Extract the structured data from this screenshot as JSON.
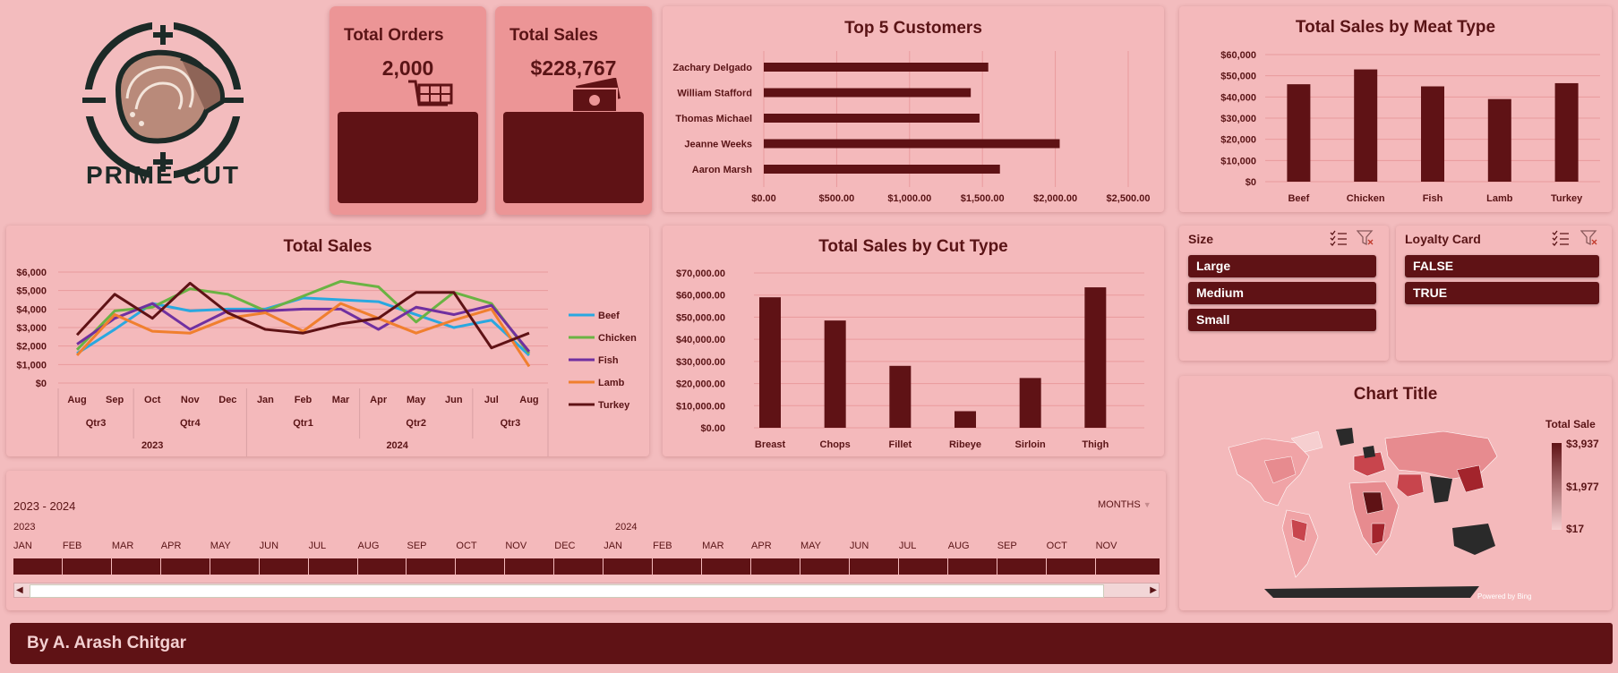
{
  "logo": {
    "text": "PRIME CUT",
    "icon": "steak-crosshair-logo"
  },
  "kpis": {
    "orders": {
      "label": "Total Orders",
      "value": "2,000",
      "icon": "shopping-cart-icon"
    },
    "sales": {
      "label": "Total Sales",
      "value": "$228,767",
      "icon": "cash-stack-icon"
    }
  },
  "top_customers": {
    "title": "Top 5 Customers",
    "xticks": [
      "$0.00",
      "$500.00",
      "$1,000.00",
      "$1,500.00",
      "$2,000.00",
      "$2,500.00"
    ]
  },
  "meat_type": {
    "title": "Total Sales by Meat Type",
    "yticks": [
      "$0",
      "$10,000",
      "$20,000",
      "$30,000",
      "$40,000",
      "$50,000",
      "$60,000"
    ]
  },
  "total_sales": {
    "title": "Total Sales",
    "yticks": [
      "$0",
      "$1,000",
      "$2,000",
      "$3,000",
      "$4,000",
      "$5,000",
      "$6,000"
    ],
    "months": [
      "Aug",
      "Sep",
      "Oct",
      "Nov",
      "Dec",
      "Jan",
      "Feb",
      "Mar",
      "Apr",
      "May",
      "Jun",
      "Jul",
      "Aug"
    ],
    "quarters": [
      "Qtr3",
      "Qtr4",
      "Qtr1",
      "Qtr2",
      "Qtr3"
    ],
    "years": [
      "2023",
      "2024"
    ]
  },
  "cut_type": {
    "title": "Total Sales by Cut Type",
    "yticks": [
      "$0.00",
      "$10,000.00",
      "$20,000.00",
      "$30,000.00",
      "$40,000.00",
      "$50,000.00",
      "$60,000.00",
      "$70,000.00"
    ]
  },
  "slicers": {
    "size": {
      "title": "Size",
      "items": [
        "Large",
        "Medium",
        "Small"
      ]
    },
    "loyalty": {
      "title": "Loyalty Card",
      "items": [
        "FALSE",
        "TRUE"
      ]
    }
  },
  "map": {
    "title": "Chart Title",
    "legend_title": "Total Sale",
    "legend_max": "$3,937",
    "legend_mid": "$1,977",
    "legend_min": "$17",
    "credit": "Powered by Bing",
    "color_low": "#f6cfd0",
    "color_high": "#5f1215"
  },
  "timeline": {
    "range": "2023 - 2024",
    "year_a": "2023",
    "year_b": "2024",
    "level": "MONTHS",
    "months": [
      "JAN",
      "FEB",
      "MAR",
      "APR",
      "MAY",
      "JUN",
      "JUL",
      "AUG",
      "SEP",
      "OCT",
      "NOV",
      "DEC",
      "JAN",
      "FEB",
      "MAR",
      "APR",
      "MAY",
      "JUN",
      "JUL",
      "AUG",
      "SEP",
      "OCT",
      "NOV"
    ]
  },
  "footer": {
    "text": "By A. Arash Chitgar"
  },
  "colors": {
    "accent": "#5f1215",
    "background": "#f3bcbe",
    "panel": "#f4b9bb",
    "kpi": "#ec9596"
  },
  "chart_data": [
    {
      "type": "bar",
      "orientation": "horizontal",
      "title": "Top 5 Customers",
      "categories": [
        "Zachary Delgado",
        "William Stafford",
        "Thomas Michael",
        "Jeanne Weeks",
        "Aaron Marsh"
      ],
      "values": [
        1540,
        1420,
        1480,
        2030,
        1620
      ],
      "xlim": [
        0,
        2500
      ]
    },
    {
      "type": "bar",
      "title": "Total Sales by Meat Type",
      "categories": [
        "Beef",
        "Chicken",
        "Fish",
        "Lamb",
        "Turkey"
      ],
      "values": [
        46000,
        53000,
        45000,
        39000,
        46500
      ],
      "ylim": [
        0,
        60000
      ]
    },
    {
      "type": "line",
      "title": "Total Sales",
      "x": [
        "Aug",
        "Sep",
        "Oct",
        "Nov",
        "Dec",
        "Jan",
        "Feb",
        "Mar",
        "Apr",
        "May",
        "Jun",
        "Jul",
        "Aug"
      ],
      "ylim": [
        0,
        6000
      ],
      "series": [
        {
          "name": "Beef",
          "color": "#29a8e0",
          "values": [
            1600,
            2900,
            4300,
            3900,
            4000,
            4000,
            4600,
            4500,
            4400,
            3700,
            3000,
            3400,
            1500
          ]
        },
        {
          "name": "Chicken",
          "color": "#6ab343",
          "values": [
            1800,
            3900,
            4100,
            5100,
            4800,
            3900,
            4700,
            5500,
            5200,
            3300,
            4900,
            4300,
            1600
          ]
        },
        {
          "name": "Fish",
          "color": "#7030a0",
          "values": [
            2100,
            3500,
            4300,
            2900,
            3900,
            3900,
            4000,
            4000,
            2900,
            4100,
            3700,
            4200,
            1700
          ]
        },
        {
          "name": "Lamb",
          "color": "#f07f2e",
          "values": [
            1500,
            3700,
            2800,
            2700,
            3500,
            3800,
            2800,
            4300,
            3500,
            2700,
            3400,
            4000,
            900
          ]
        },
        {
          "name": "Turkey",
          "color": "#5f1215",
          "values": [
            2600,
            4800,
            3500,
            5400,
            3800,
            2900,
            2700,
            3200,
            3500,
            4900,
            4900,
            1900,
            2700
          ]
        }
      ]
    },
    {
      "type": "bar",
      "title": "Total Sales by Cut Type",
      "categories": [
        "Breast",
        "Chops",
        "Fillet",
        "Ribeye",
        "Sirloin",
        "Thigh"
      ],
      "values": [
        59000,
        48500,
        28000,
        7500,
        22500,
        63500
      ],
      "ylim": [
        0,
        70000
      ]
    }
  ]
}
